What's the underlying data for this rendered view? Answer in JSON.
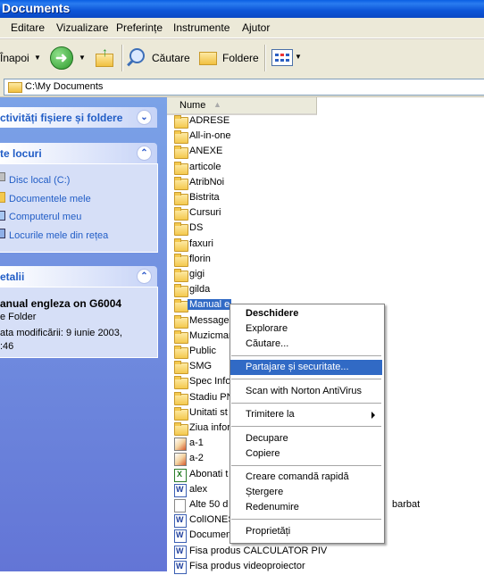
{
  "window": {
    "title": "Documents"
  },
  "menu": [
    "Editare",
    "Vizualizare",
    "Preferințe",
    "Instrumente",
    "Ajutor"
  ],
  "toolbar": {
    "back_label": "Înapoi",
    "search_label": "Căutare",
    "folders_label": "Foldere"
  },
  "address": {
    "value": "C:\\My Documents"
  },
  "tasks": {
    "file_tasks_title": "ctivități fișiere și foldere",
    "places_title": "te locuri",
    "places": [
      "Disc local (C:)",
      "Documentele mele",
      "Computerul meu",
      "Locurile mele din rețea"
    ],
    "details_title": "etalii",
    "details_name": "anual engleza on G6004",
    "details_type": "e Folder",
    "details_modified_line1": "ata modificării: 9 iunie 2003,",
    "details_modified_line2": ":46"
  },
  "list": {
    "column_name": "Nume",
    "items": [
      {
        "name": "ADRESE",
        "icon": "folder-icon"
      },
      {
        "name": "All-in-one",
        "icon": "folder-icon"
      },
      {
        "name": "ANEXE",
        "icon": "folder-icon"
      },
      {
        "name": "articole",
        "icon": "folder-icon"
      },
      {
        "name": "AtribNoi",
        "icon": "folder-icon"
      },
      {
        "name": "Bistrita",
        "icon": "folder-icon"
      },
      {
        "name": "Cursuri",
        "icon": "folder-icon"
      },
      {
        "name": "DS",
        "icon": "folder-icon"
      },
      {
        "name": "faxuri",
        "icon": "folder-icon"
      },
      {
        "name": "florin",
        "icon": "folder-icon"
      },
      {
        "name": "gigi",
        "icon": "folder-icon"
      },
      {
        "name": "gilda",
        "icon": "folder-icon"
      },
      {
        "name": "Manual e",
        "icon": "folder-icon",
        "selected": true
      },
      {
        "name": "Message",
        "icon": "folder-icon"
      },
      {
        "name": "Muzicmar",
        "icon": "folder-icon"
      },
      {
        "name": "Public",
        "icon": "folder-icon"
      },
      {
        "name": "SMG",
        "icon": "folder-icon"
      },
      {
        "name": "Spec Info",
        "icon": "folder-icon"
      },
      {
        "name": "Stadiu PN",
        "icon": "folder-icon"
      },
      {
        "name": "Unitati st",
        "icon": "folder-icon"
      },
      {
        "name": "Ziua infor",
        "icon": "folder-icon"
      },
      {
        "name": "a-1",
        "icon": "image-icon"
      },
      {
        "name": "a-2",
        "icon": "image-icon"
      },
      {
        "name": "Abonati t",
        "icon": "excel-icon"
      },
      {
        "name": "alex",
        "icon": "word-icon"
      },
      {
        "name": "Alte 50 d",
        "icon": "text-icon",
        "extra": "barbat"
      },
      {
        "name": "ColIONES",
        "icon": "word-icon"
      },
      {
        "name": "Documen",
        "icon": "word-icon"
      },
      {
        "name": "Fisa produs CALCULATOR PIV",
        "icon": "word-icon"
      },
      {
        "name": "Fisa produs videoproiector",
        "icon": "word-icon"
      }
    ]
  },
  "context_menu": {
    "open": "Deschidere",
    "explore": "Explorare",
    "search": "Căutare...",
    "sharing": "Partajare și securitate...",
    "norton": "Scan with Norton AntiVirus",
    "send_to": "Trimitere la",
    "cut": "Decupare",
    "copy": "Copiere",
    "shortcut": "Creare comandă rapidă",
    "delete": "Ștergere",
    "rename": "Redenumire",
    "properties": "Proprietăți"
  }
}
